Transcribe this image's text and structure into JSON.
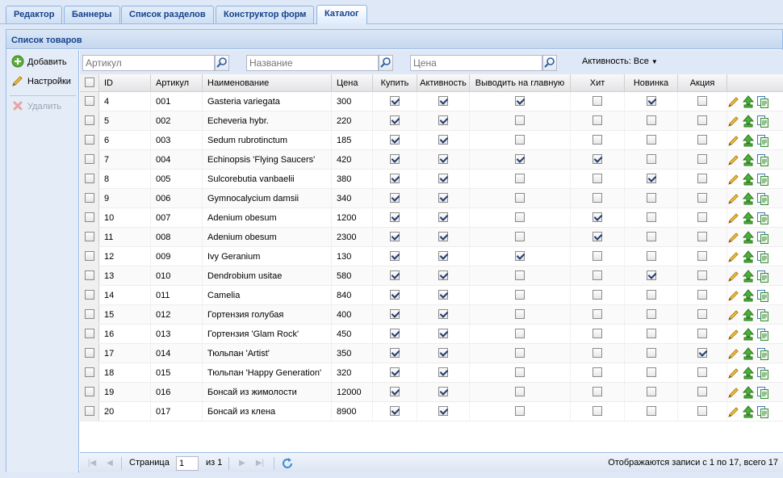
{
  "tabs": [
    {
      "label": "Редактор",
      "active": false
    },
    {
      "label": "Баннеры",
      "active": false
    },
    {
      "label": "Список разделов",
      "active": false
    },
    {
      "label": "Конструктор форм",
      "active": false
    },
    {
      "label": "Каталог",
      "active": true
    }
  ],
  "panel": {
    "title": "Список товаров"
  },
  "sidebar": {
    "add_label": "Добавить",
    "settings_label": "Настройки",
    "delete_label": "Удалить"
  },
  "filters": {
    "article_placeholder": "Артикул",
    "name_placeholder": "Название",
    "price_placeholder": "Цена",
    "activity_label": "Активность: Все"
  },
  "grid": {
    "columns": [
      "ID",
      "Артикул",
      "Наименование",
      "Цена",
      "Купить",
      "Активность",
      "Выводить на главную",
      "Хит",
      "Новинка",
      "Акция"
    ],
    "rows": [
      {
        "id": "4",
        "article": "001",
        "name": "Gasteria variegata",
        "price": "300",
        "buy": true,
        "active": true,
        "main": true,
        "hit": false,
        "new": true,
        "sale": false
      },
      {
        "id": "5",
        "article": "002",
        "name": "Echeveria hybr.",
        "price": "220",
        "buy": true,
        "active": true,
        "main": false,
        "hit": false,
        "new": false,
        "sale": false
      },
      {
        "id": "6",
        "article": "003",
        "name": "Sedum rubrotinctum",
        "price": "185",
        "buy": true,
        "active": true,
        "main": false,
        "hit": false,
        "new": false,
        "sale": false
      },
      {
        "id": "7",
        "article": "004",
        "name": "Echinopsis 'Flying Saucers'",
        "price": "420",
        "buy": true,
        "active": true,
        "main": true,
        "hit": true,
        "new": false,
        "sale": false
      },
      {
        "id": "8",
        "article": "005",
        "name": "Sulcorebutia vanbaelii",
        "price": "380",
        "buy": true,
        "active": true,
        "main": false,
        "hit": false,
        "new": true,
        "sale": false
      },
      {
        "id": "9",
        "article": "006",
        "name": "Gymnocalycium damsii",
        "price": "340",
        "buy": true,
        "active": true,
        "main": false,
        "hit": false,
        "new": false,
        "sale": false
      },
      {
        "id": "10",
        "article": "007",
        "name": "Adenium obesum",
        "price": "1200",
        "buy": true,
        "active": true,
        "main": false,
        "hit": true,
        "new": false,
        "sale": false
      },
      {
        "id": "11",
        "article": "008",
        "name": "Adenium obesum",
        "price": "2300",
        "buy": true,
        "active": true,
        "main": false,
        "hit": true,
        "new": false,
        "sale": false
      },
      {
        "id": "12",
        "article": "009",
        "name": "Ivy Geranium",
        "price": "130",
        "buy": true,
        "active": true,
        "main": true,
        "hit": false,
        "new": false,
        "sale": false
      },
      {
        "id": "13",
        "article": "010",
        "name": "Dendrobium usitae",
        "price": "580",
        "buy": true,
        "active": true,
        "main": false,
        "hit": false,
        "new": true,
        "sale": false
      },
      {
        "id": "14",
        "article": "011",
        "name": "Camelia",
        "price": "840",
        "buy": true,
        "active": true,
        "main": false,
        "hit": false,
        "new": false,
        "sale": false
      },
      {
        "id": "15",
        "article": "012",
        "name": "Гортензия голубая",
        "price": "400",
        "buy": true,
        "active": true,
        "main": false,
        "hit": false,
        "new": false,
        "sale": false
      },
      {
        "id": "16",
        "article": "013",
        "name": "Гортензия 'Glam Rock'",
        "price": "450",
        "buy": true,
        "active": true,
        "main": false,
        "hit": false,
        "new": false,
        "sale": false
      },
      {
        "id": "17",
        "article": "014",
        "name": "Тюльпан 'Artist'",
        "price": "350",
        "buy": true,
        "active": true,
        "main": false,
        "hit": false,
        "new": false,
        "sale": true
      },
      {
        "id": "18",
        "article": "015",
        "name": "Тюльпан 'Happy Generation'",
        "price": "320",
        "buy": true,
        "active": true,
        "main": false,
        "hit": false,
        "new": false,
        "sale": false
      },
      {
        "id": "19",
        "article": "016",
        "name": "Бонсай из жимолости",
        "price": "12000",
        "buy": true,
        "active": true,
        "main": false,
        "hit": false,
        "new": false,
        "sale": false
      },
      {
        "id": "20",
        "article": "017",
        "name": "Бонсай из клена",
        "price": "8900",
        "buy": true,
        "active": true,
        "main": false,
        "hit": false,
        "new": false,
        "sale": false
      }
    ]
  },
  "paging": {
    "page_label": "Страница",
    "page_value": "1",
    "of_label": "из 1",
    "summary": "Отображаются записи с 1 по 17, всего 17"
  },
  "icons": {
    "add": "add-circle-icon",
    "settings": "pencil-icon",
    "delete": "delete-x-icon",
    "search": "magnifier-icon",
    "edit": "pencil-icon",
    "move_up": "tree-up-icon",
    "copy": "copy-page-icon",
    "refresh": "refresh-icon"
  },
  "colors": {
    "tab_text": "#15428b",
    "panel_border": "#99bbe8",
    "background": "#dfe8f6"
  }
}
